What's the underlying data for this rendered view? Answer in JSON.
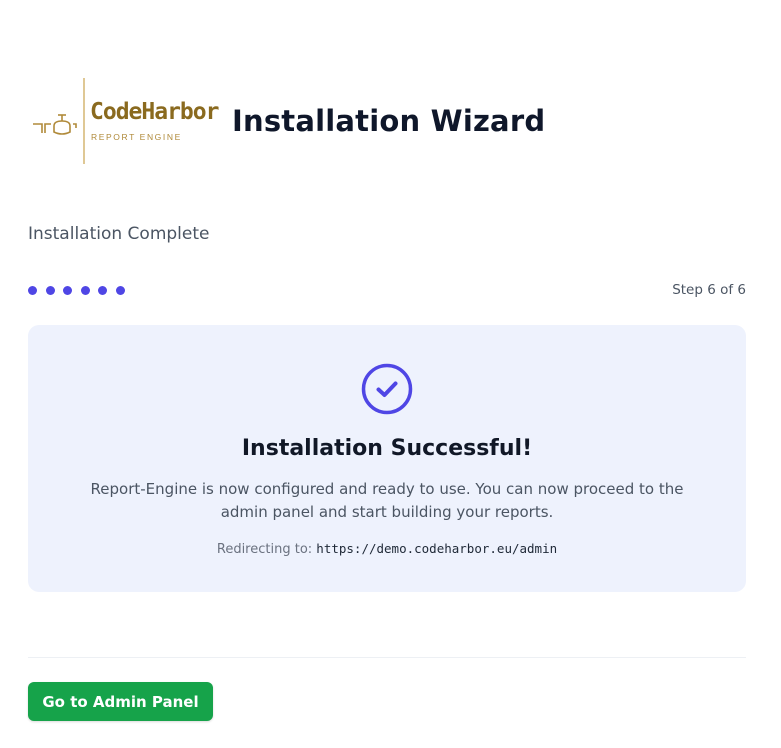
{
  "header": {
    "logo": {
      "name": "CodeHarbor",
      "subtitle": "REPORT ENGINE"
    },
    "title": "Installation Wizard"
  },
  "step": {
    "title": "Installation Complete",
    "current": 6,
    "total": 6,
    "label": "Step 6 of 6"
  },
  "result": {
    "icon": "check-circle-icon",
    "title": "Installation Successful!",
    "message": "Report-Engine is now configured and ready to use. You can now proceed to the admin panel and start building your reports.",
    "redirect_label": "Redirecting to:",
    "redirect_url": "https://demo.codeharbor.eu/admin"
  },
  "actions": {
    "primary_label": "Go to Admin Panel"
  },
  "colors": {
    "accent": "#4f46e5",
    "success_button": "#16a34a",
    "card_background": "#eef2fd",
    "logo_gold": "#8a6a1f"
  }
}
